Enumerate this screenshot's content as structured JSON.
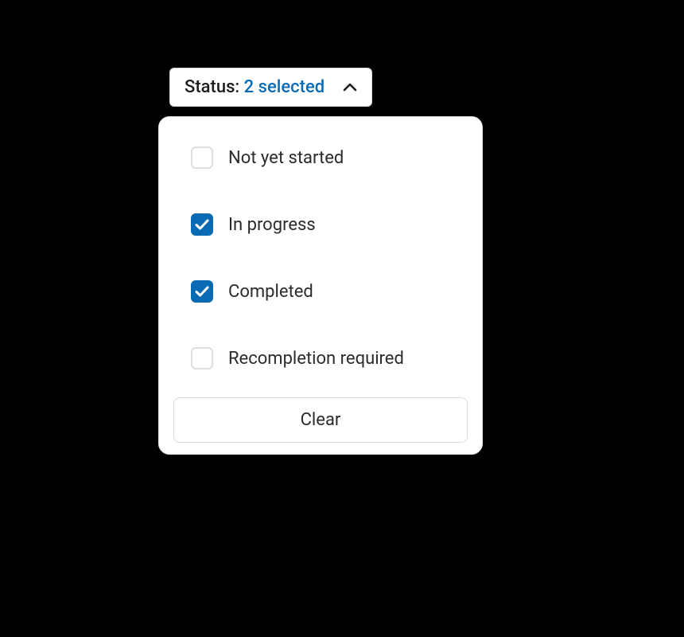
{
  "filter": {
    "label": "Status: ",
    "value": "2 selected",
    "options": [
      {
        "label": "Not yet started",
        "checked": false
      },
      {
        "label": "In progress",
        "checked": true
      },
      {
        "label": "Completed",
        "checked": true
      },
      {
        "label": "Recompletion required",
        "checked": false
      }
    ],
    "clear_label": "Clear"
  }
}
